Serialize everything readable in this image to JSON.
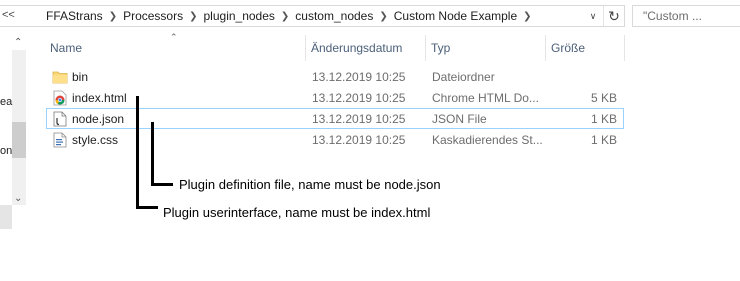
{
  "address": {
    "overflow": "<<",
    "breadcrumb": [
      "FFAStrans",
      "Processors",
      "plugin_nodes",
      "custom_nodes",
      "Custom Node Example"
    ],
    "search_placeholder": "\"Custom ..."
  },
  "nav": {
    "partial_labels": [
      "ea",
      "on"
    ]
  },
  "columns": {
    "name": "Name",
    "date": "Änderungsdatum",
    "type": "Typ",
    "size": "Größe"
  },
  "files": [
    {
      "name": "bin",
      "date": "13.12.2019 10:25",
      "type": "Dateiordner",
      "size": "",
      "icon": "folder-icon"
    },
    {
      "name": "index.html",
      "date": "13.12.2019 10:25",
      "type": "Chrome HTML Do...",
      "size": "5 KB",
      "icon": "chrome-html-icon"
    },
    {
      "name": "node.json",
      "date": "13.12.2019 10:25",
      "type": "JSON File",
      "size": "1 KB",
      "icon": "json-file-icon"
    },
    {
      "name": "style.css",
      "date": "13.12.2019 10:25",
      "type": "Kaskadierendes St...",
      "size": "1 KB",
      "icon": "css-file-icon"
    }
  ],
  "annotations": {
    "node_json": "Plugin definition file, name must be node.json",
    "index_html": "Plugin userinterface, name must be index.html"
  }
}
